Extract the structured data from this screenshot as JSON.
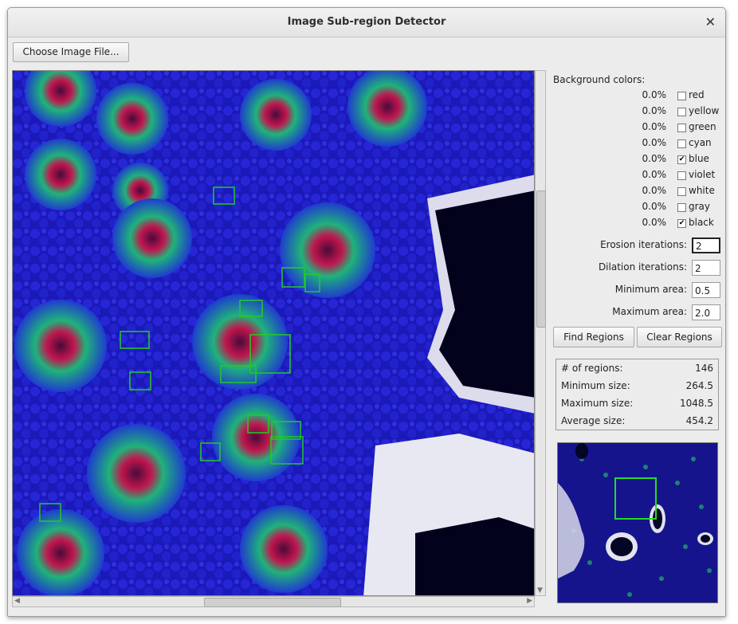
{
  "window": {
    "title": "Image Sub-region Detector"
  },
  "toolbar": {
    "choose_file_label": "Choose Image File..."
  },
  "background": {
    "heading": "Background colors:",
    "colors": [
      {
        "pct": "0.0%",
        "label": "red",
        "checked": false
      },
      {
        "pct": "0.0%",
        "label": "yellow",
        "checked": false
      },
      {
        "pct": "0.0%",
        "label": "green",
        "checked": false
      },
      {
        "pct": "0.0%",
        "label": "cyan",
        "checked": false
      },
      {
        "pct": "0.0%",
        "label": "blue",
        "checked": true
      },
      {
        "pct": "0.0%",
        "label": "violet",
        "checked": false
      },
      {
        "pct": "0.0%",
        "label": "white",
        "checked": false
      },
      {
        "pct": "0.0%",
        "label": "gray",
        "checked": false
      },
      {
        "pct": "0.0%",
        "label": "black",
        "checked": true
      }
    ]
  },
  "params": [
    {
      "label": "Erosion iterations:",
      "value": "2"
    },
    {
      "label": "Dilation iterations:",
      "value": "2"
    },
    {
      "label": "Minimum area:",
      "value": "0.5"
    },
    {
      "label": "Maximum area:",
      "value": "2.0"
    }
  ],
  "actions": {
    "find_label": "Find Regions",
    "clear_label": "Clear Regions"
  },
  "stats": [
    {
      "label": "# of regions:",
      "value": "146"
    },
    {
      "label": "Minimum size:",
      "value": "264.5"
    },
    {
      "label": "Maximum size:",
      "value": "1048.5"
    },
    {
      "label": "Average size:",
      "value": "454.2"
    }
  ],
  "colors": {
    "region_box": "#22cc22",
    "tissue_blue": "#1a17b6",
    "checkmark": "✔"
  }
}
